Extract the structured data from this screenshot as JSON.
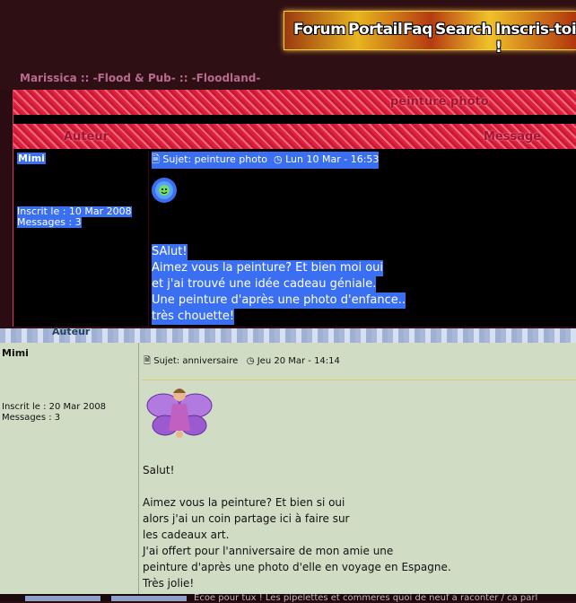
{
  "banner": {
    "links": [
      "Forum",
      "Portail",
      "Faq",
      "Search",
      "Inscris-toi !"
    ]
  },
  "breadcrumb": "Marissica :: -Flood & Pub- :: -Floodland-",
  "topic_title": "peinture photo",
  "table_headers": {
    "author": "Auteur",
    "message": "Message"
  },
  "posts": [
    {
      "author": "Mimi",
      "joined": "Inscrit le : 10 Mar 2008",
      "messages": "Messages : 3",
      "subject": "Sujet: peinture photo",
      "date": "Lun 10 Mar - 16:53",
      "lines": [
        "SAlut!",
        "Aimez vous la peinture? Et bien moi oui",
        "et j'ai trouvé une idée cadeau géniale.",
        "Une peinture d'après une photo d'enfance..",
        "très chouette!"
      ]
    },
    {
      "author": "Mimi",
      "joined": "Inscrit le : 20 Mar 2008",
      "messages": "Messages : 3",
      "subject": "Sujet: anniversaire",
      "date": "Jeu 20 Mar - 14:14",
      "lines": [
        "Salut!",
        "",
        "Aimez vous la peinture? Et bien si oui",
        "alors j'ai un coin partage ici à faire sur",
        "les cadeaux art.",
        "J'ai offert pour l'anniversaire de mon amie une",
        "peinture d'après une photo d'elle en voyage en Espagne.",
        "Très jolie!"
      ]
    }
  ],
  "next_topic_snippet": "Ecoe pour tux ! Les pipelettes et commeres quoi de neuf a raconter / ca parl",
  "colors": {
    "pink_band": "#e0203f",
    "selection": "#3a6ff2",
    "green_post": "#d0ddc4",
    "blue_band": "#a9b8d8"
  }
}
